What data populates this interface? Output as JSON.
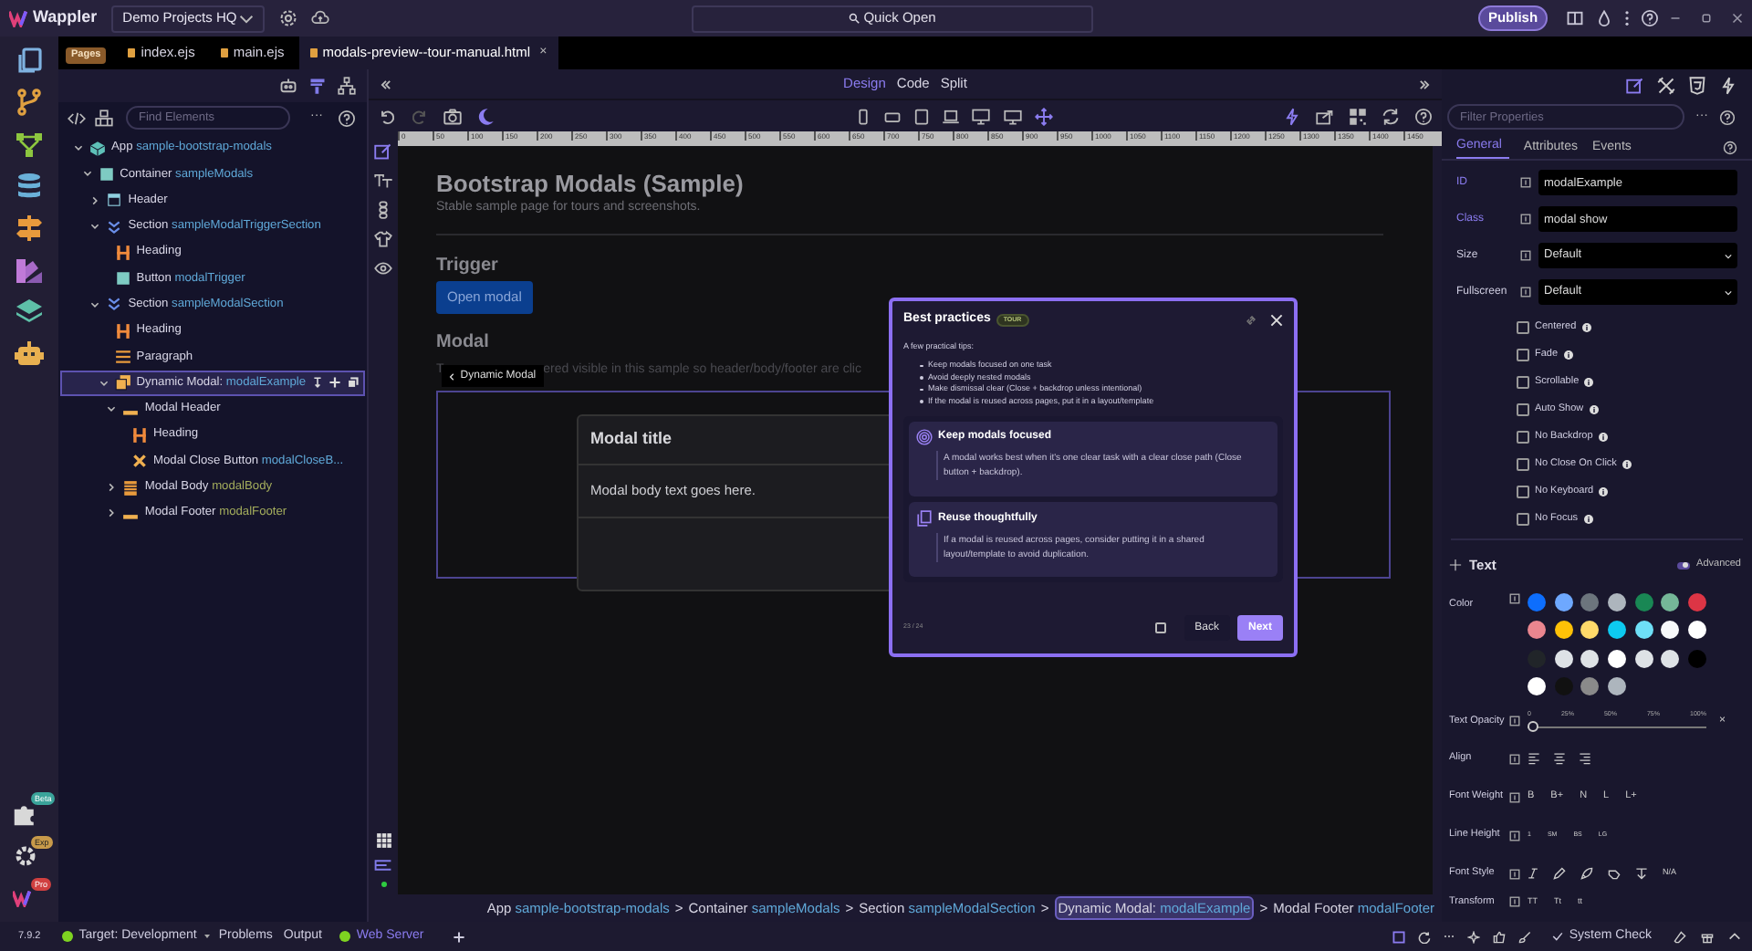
{
  "app": {
    "logo": "Wappler",
    "project": "Demo Projects HQ",
    "quick_open": "Quick Open",
    "publish": "Publish"
  },
  "rail_badges": [
    "Beta",
    "Exp",
    "Pro"
  ],
  "file_tabs": {
    "badge": "Pages",
    "tabs": [
      {
        "label": "index.ejs",
        "selected": false
      },
      {
        "label": "main.ejs",
        "selected": false
      },
      {
        "label": "modals-preview--tour-manual.html",
        "selected": true
      }
    ],
    "close": "×"
  },
  "structure": {
    "search_placeholder": "Find Elements",
    "more": "···",
    "tree": [
      {
        "type": "App",
        "id": "sample-bootstrap-modals",
        "color": "#5fa8d8",
        "kind": "app",
        "expanded": true,
        "selected": false,
        "children": [
          {
            "type": "Container",
            "id": "sampleModals",
            "color": "#5fa8d8",
            "kind": "container",
            "expanded": true,
            "selected": false,
            "children": [
              {
                "type": "Header",
                "kind": "header",
                "expanded": false,
                "selected": false
              },
              {
                "type": "Section",
                "id": "sampleModalTriggerSection",
                "color": "#5fa8d8",
                "kind": "section",
                "expanded": true,
                "selected": false,
                "children": [
                  {
                    "type": "Heading",
                    "kind": "heading",
                    "selected": false
                  },
                  {
                    "type": "Button",
                    "id": "modalTrigger",
                    "color": "#5fa8d8",
                    "kind": "button",
                    "selected": false
                  }
                ]
              },
              {
                "type": "Section",
                "id": "sampleModalSection",
                "color": "#5fa8d8",
                "kind": "section",
                "expanded": true,
                "selected": false,
                "children": [
                  {
                    "type": "Heading",
                    "kind": "heading",
                    "selected": false
                  },
                  {
                    "type": "Paragraph",
                    "kind": "paragraph",
                    "selected": false
                  },
                  {
                    "type": "Dynamic Modal:",
                    "id": "modalExample",
                    "color": "#5fa8d8",
                    "kind": "modal",
                    "expanded": true,
                    "selected": true,
                    "children": [
                      {
                        "type": "Modal Header",
                        "kind": "bar",
                        "expanded": true,
                        "selected": false,
                        "children": [
                          {
                            "type": "Heading",
                            "kind": "heading",
                            "selected": false
                          },
                          {
                            "type": "Modal Close Button",
                            "id": "modalCloseB...",
                            "color": "#5fa8d8",
                            "kind": "close",
                            "selected": false
                          }
                        ]
                      },
                      {
                        "type": "Modal Body",
                        "id": "modalBody",
                        "color": "#a3ac5c",
                        "kind": "lines",
                        "expanded": false,
                        "selected": false
                      },
                      {
                        "type": "Modal Footer",
                        "id": "modalFooter",
                        "color": "#a3ac5c",
                        "kind": "bar",
                        "expanded": false,
                        "selected": false
                      }
                    ]
                  }
                ]
              }
            ]
          }
        ]
      }
    ]
  },
  "view_tabs": [
    {
      "label": "Design",
      "selected": true
    },
    {
      "label": "Code",
      "selected": false
    },
    {
      "label": "Split",
      "selected": false
    }
  ],
  "ruler": [
    "0",
    "50",
    "100",
    "150",
    "200",
    "250",
    "300",
    "350",
    "400",
    "450",
    "500",
    "550",
    "600",
    "650",
    "700",
    "750",
    "800",
    "850",
    "900",
    "950",
    "1000",
    "1050",
    "1100",
    "1150",
    "1200",
    "1250",
    "1300",
    "1350",
    "1400",
    "1450"
  ],
  "canvas": {
    "title": "Bootstrap Modals (Sample)",
    "subtitle": "Stable sample page for tours and screenshots.",
    "trigger_heading": "Trigger",
    "trigger_button": "Open modal",
    "modal_heading": "Modal",
    "paragraph": [
      "T",
      "ered visible in this sample so header/body/footer are clic"
    ],
    "tooltip": "Dynamic Modal",
    "modal_title": "Modal title",
    "modal_body": "Modal body text goes here."
  },
  "tour": {
    "title": "Best practices",
    "badge": "TOUR",
    "intro": "A few practical tips:",
    "bullets": [
      "Keep modals focused on one task",
      "Avoid deeply nested modals",
      "Make dismissal clear (Close + backdrop unless intentional)",
      "If the modal is reused across pages, put it in a layout/template"
    ],
    "cards": [
      {
        "kind": "target",
        "title": "Keep modals focused",
        "text": "A modal works best when it's one clear task with a clear close path (Close button + backdrop)."
      },
      {
        "kind": "copy",
        "title": "Reuse thoughtfully",
        "text": "If a modal is reused across pages, consider putting it in a shared layout/template to avoid duplication."
      }
    ],
    "step": "23 / 24",
    "checked": false,
    "back": "Back",
    "next": "Next"
  },
  "breadcrumb": {
    "separator": ">",
    "items": [
      {
        "type": "App",
        "id": "sample-bootstrap-modals",
        "selected": false
      },
      {
        "type": "Container",
        "id": "sampleModals",
        "selected": false
      },
      {
        "type": "Section",
        "id": "sampleModalSection",
        "selected": false
      },
      {
        "type": "Dynamic Modal:",
        "id": "modalExample",
        "selected": true
      },
      {
        "type": "Modal Footer",
        "id": "modalFooter",
        "selected": false
      }
    ]
  },
  "properties": {
    "filter_placeholder": "Filter Properties",
    "more": "···",
    "tabs": [
      {
        "label": "General",
        "selected": true
      },
      {
        "label": "Attributes",
        "selected": false
      },
      {
        "label": "Events",
        "selected": false
      }
    ],
    "fields": [
      {
        "label": "ID",
        "kind": "text",
        "value": "modalExample",
        "set": true
      },
      {
        "label": "Class",
        "kind": "text",
        "value": "modal show",
        "set": true
      },
      {
        "label": "Size",
        "kind": "select",
        "value": "Default",
        "set": false
      },
      {
        "label": "Fullscreen",
        "kind": "select",
        "value": "Default",
        "set": false
      }
    ],
    "options": [
      {
        "label": "Centered",
        "checked": false
      },
      {
        "label": "Fade",
        "checked": false
      },
      {
        "label": "Scrollable",
        "checked": false
      },
      {
        "label": "Auto Show",
        "checked": false
      },
      {
        "label": "No Backdrop",
        "checked": false
      },
      {
        "label": "No Close On Click",
        "checked": false
      },
      {
        "label": "No Keyboard",
        "checked": false
      },
      {
        "label": "No Focus",
        "checked": false
      }
    ]
  },
  "text_section": {
    "title": "Text",
    "advanced": {
      "label": "Advanced",
      "on": true
    },
    "color_label": "Color",
    "swatches": [
      {
        "color": "#0d6efd"
      },
      {
        "color": "#6ea8fe"
      },
      {
        "color": "#6c757d"
      },
      {
        "color": "#adb5bd"
      },
      {
        "color": "#198754"
      },
      {
        "color": "#75b798"
      },
      {
        "color": "#dc3545"
      },
      {
        "color": "#ea868f"
      },
      {
        "color": "#ffc107"
      },
      {
        "color": "#ffda6a"
      },
      {
        "color": "#0dcaf0"
      },
      {
        "color": "#6edff6"
      },
      {
        "color": "#f8f9fa"
      },
      {
        "color": "#ffffff"
      },
      {
        "color": "#212529"
      },
      {
        "color": "#dee2e6"
      },
      {
        "color": "#dee2e6"
      },
      {
        "color": "#ffffff"
      },
      {
        "color": "#dee2e6"
      },
      {
        "color": "#dee2e6"
      },
      {
        "color": "#000000"
      },
      {
        "color": "#ffffff"
      },
      {
        "color": "#111111"
      },
      {
        "color": "#8a8a8a"
      },
      {
        "color": "#adb5bd"
      }
    ],
    "opacity": {
      "label": "Text Opacity",
      "ticks": [
        "0",
        "25%",
        "50%",
        "75%",
        "100%"
      ],
      "level": 0,
      "clear": "×"
    },
    "align_label": "Align",
    "weight": {
      "label": "Font Weight",
      "options": [
        "B",
        "B+",
        "N",
        "L",
        "L+"
      ]
    },
    "line_height": {
      "label": "Line Height",
      "options": [
        "1",
        "SM",
        "BS",
        "LG"
      ]
    },
    "font_style": {
      "label": "Font Style",
      "none": "N/A"
    },
    "transform": {
      "label": "Transform",
      "options": [
        "TT",
        "Tt",
        "tt"
      ]
    }
  },
  "status": {
    "version": "7.9.2",
    "target": "Target: Development",
    "problems": "Problems",
    "output": "Output",
    "server": {
      "label": "Web Server",
      "running": true
    },
    "system_check": "System Check"
  }
}
